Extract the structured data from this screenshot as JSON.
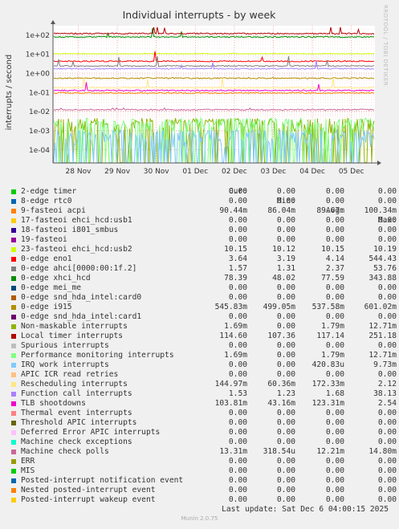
{
  "side_text": "RRDTOOL / TOBI OETIKER",
  "footer": "Munin 2.0.75",
  "last_update": "Last update: Sat Dec  6 04:00:15 2025",
  "legend_headers": [
    "Cur:",
    "Min:",
    "Avg:",
    "Max:"
  ],
  "chart_data": {
    "type": "line",
    "title": "Individual interrupts - by week",
    "ylabel": "interrupts / second",
    "yscale": "log",
    "ylim": [
      2e-05,
      300
    ],
    "yticks": [
      "1e-04",
      "1e-03",
      "1e-02",
      "1e-01",
      "1e+00",
      "1e+01",
      "1e+02"
    ],
    "xticks": [
      "28 Nov",
      "29 Nov",
      "30 Nov",
      "01 Dec",
      "02 Dec",
      "03 Dec",
      "04 Dec",
      "05 Dec"
    ],
    "grid": true,
    "series": [
      {
        "name": "2-edge timer",
        "color": "#00cc00",
        "cur": "0.00",
        "min": "0.00",
        "avg": "0.00",
        "max": "0.00"
      },
      {
        "name": "8-edge rtc0",
        "color": "#0066b3",
        "cur": "0.00",
        "min": "0.00",
        "avg": "0.00",
        "max": "0.00"
      },
      {
        "name": "9-fasteoi acpi",
        "color": "#ff8000",
        "cur": "90.44m",
        "min": "86.04m",
        "avg": "89.67m",
        "max": "100.34m"
      },
      {
        "name": "17-fasteoi ehci_hcd:usb1",
        "color": "#ffcc00",
        "cur": "0.00",
        "min": "0.00",
        "avg": "0.00",
        "max": "0.00"
      },
      {
        "name": "18-fasteoi i801_smbus",
        "color": "#330099",
        "cur": "0.00",
        "min": "0.00",
        "avg": "0.00",
        "max": "0.00"
      },
      {
        "name": "19-fasteoi",
        "color": "#990099",
        "cur": "0.00",
        "min": "0.00",
        "avg": "0.00",
        "max": "0.00"
      },
      {
        "name": "23-fasteoi ehci_hcd:usb2",
        "color": "#ccff00",
        "cur": "10.15",
        "min": "10.12",
        "avg": "10.15",
        "max": "10.19"
      },
      {
        "name": "0-edge eno1",
        "color": "#ff0000",
        "cur": "3.64",
        "min": "3.19",
        "avg": "4.14",
        "max": "544.43"
      },
      {
        "name": "0-edge ahci[0000:00:1f.2]",
        "color": "#808080",
        "cur": "1.57",
        "min": "1.31",
        "avg": "2.37",
        "max": "53.76"
      },
      {
        "name": "0-edge xhci_hcd",
        "color": "#008f00",
        "cur": "78.39",
        "min": "48.02",
        "avg": "77.59",
        "max": "343.88"
      },
      {
        "name": "0-edge mei_me",
        "color": "#00487d",
        "cur": "0.00",
        "min": "0.00",
        "avg": "0.00",
        "max": "0.00"
      },
      {
        "name": "0-edge snd_hda_intel:card0",
        "color": "#b35a00",
        "cur": "0.00",
        "min": "0.00",
        "avg": "0.00",
        "max": "0.00"
      },
      {
        "name": "0-edge i915",
        "color": "#b38f00",
        "cur": "545.83m",
        "min": "499.05m",
        "avg": "537.58m",
        "max": "601.02m"
      },
      {
        "name": "0-edge snd_hda_intel:card1",
        "color": "#6b006b",
        "cur": "0.00",
        "min": "0.00",
        "avg": "0.00",
        "max": "0.00"
      },
      {
        "name": "Non-maskable interrupts",
        "color": "#8fb300",
        "cur": "1.69m",
        "min": "0.00",
        "avg": "1.79m",
        "max": "12.71m"
      },
      {
        "name": "Local timer interrupts",
        "color": "#b30000",
        "cur": "114.60",
        "min": "107.36",
        "avg": "117.14",
        "max": "251.18"
      },
      {
        "name": "Spurious interrupts",
        "color": "#bebebe",
        "cur": "0.00",
        "min": "0.00",
        "avg": "0.00",
        "max": "0.00"
      },
      {
        "name": "Performance monitoring interrupts",
        "color": "#80ff80",
        "cur": "1.69m",
        "min": "0.00",
        "avg": "1.79m",
        "max": "12.71m"
      },
      {
        "name": "IRQ work interrupts",
        "color": "#80c9ff",
        "cur": "0.00",
        "min": "0.00",
        "avg": "420.83u",
        "max": "9.73m"
      },
      {
        "name": "APIC ICR read retries",
        "color": "#ffc080",
        "cur": "0.00",
        "min": "0.00",
        "avg": "0.00",
        "max": "0.00"
      },
      {
        "name": "Rescheduling interrupts",
        "color": "#ffe680",
        "cur": "144.97m",
        "min": "60.36m",
        "avg": "172.33m",
        "max": "2.12"
      },
      {
        "name": "Function call interrupts",
        "color": "#aa80ff",
        "cur": "1.53",
        "min": "1.23",
        "avg": "1.68",
        "max": "38.13"
      },
      {
        "name": "TLB shootdowns",
        "color": "#ee00cc",
        "cur": "103.81m",
        "min": "43.16m",
        "avg": "123.31m",
        "max": "2.54"
      },
      {
        "name": "Thermal event interrupts",
        "color": "#ff8080",
        "cur": "0.00",
        "min": "0.00",
        "avg": "0.00",
        "max": "0.00"
      },
      {
        "name": "Threshold APIC interrupts",
        "color": "#666600",
        "cur": "0.00",
        "min": "0.00",
        "avg": "0.00",
        "max": "0.00"
      },
      {
        "name": "Deferred Error APIC interrupts",
        "color": "#ffbfff",
        "cur": "0.00",
        "min": "0.00",
        "avg": "0.00",
        "max": "0.00"
      },
      {
        "name": "Machine check exceptions",
        "color": "#00ffcc",
        "cur": "0.00",
        "min": "0.00",
        "avg": "0.00",
        "max": "0.00"
      },
      {
        "name": "Machine check polls",
        "color": "#cc6699",
        "cur": "13.31m",
        "min": "318.54u",
        "avg": "12.21m",
        "max": "14.80m"
      },
      {
        "name": "ERR",
        "color": "#999900",
        "cur": "0.00",
        "min": "0.00",
        "avg": "0.00",
        "max": "0.00"
      },
      {
        "name": "MIS",
        "color": "#00cc00",
        "cur": "0.00",
        "min": "0.00",
        "avg": "0.00",
        "max": "0.00"
      },
      {
        "name": "Posted-interrupt notification event",
        "color": "#0066b3",
        "cur": "0.00",
        "min": "0.00",
        "avg": "0.00",
        "max": "0.00"
      },
      {
        "name": "Nested posted-interrupt event",
        "color": "#ff8000",
        "cur": "0.00",
        "min": "0.00",
        "avg": "0.00",
        "max": "0.00"
      },
      {
        "name": "Posted-interrupt wakeup event",
        "color": "#ffcc00",
        "cur": "0.00",
        "min": "0.00",
        "avg": "0.00",
        "max": "0.00"
      }
    ]
  }
}
